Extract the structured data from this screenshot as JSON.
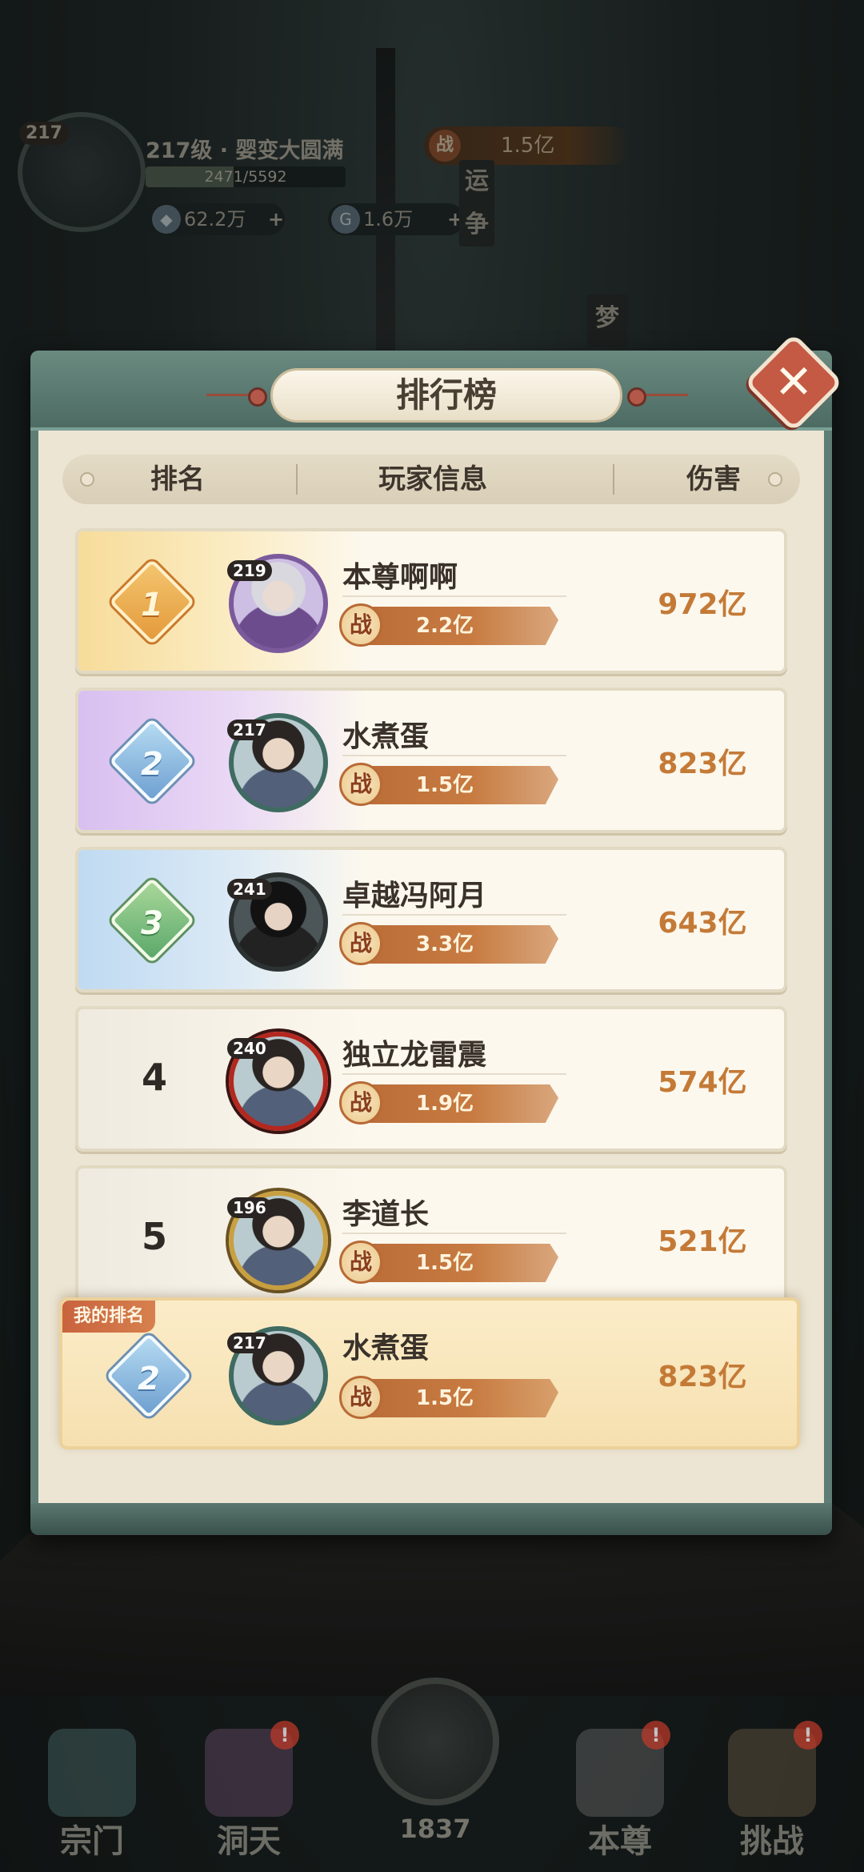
{
  "hud": {
    "player_level": "217",
    "rank_text": "217级 · 婴变大圆满",
    "exp_text": "2471/5592",
    "exp_fraction": 0.4419,
    "res1_value": "62.2万",
    "res2_value": "1.6万",
    "plus": "+",
    "power_label": "战",
    "power_value": "1.5亿",
    "side_text": "运争",
    "meng": "梦"
  },
  "dialog": {
    "title": "排行榜",
    "close_icon": "close-icon",
    "columns": [
      "排名",
      "玩家信息",
      "伤害"
    ],
    "power_label": "战",
    "rows": [
      {
        "rank": "1",
        "level": "219",
        "name": "本尊啊啊",
        "power": "2.2亿",
        "damage": "972亿"
      },
      {
        "rank": "2",
        "level": "217",
        "name": "水煮蛋",
        "power": "1.5亿",
        "damage": "823亿"
      },
      {
        "rank": "3",
        "level": "241",
        "name": "卓越冯阿月",
        "power": "3.3亿",
        "damage": "643亿"
      },
      {
        "rank": "4",
        "level": "240",
        "name": "独立龙雷震",
        "power": "1.9亿",
        "damage": "574亿"
      },
      {
        "rank": "5",
        "level": "196",
        "name": "李道长",
        "power": "1.5亿",
        "damage": "521亿"
      }
    ],
    "mine": {
      "tag": "我的排名",
      "rank": "2",
      "level": "217",
      "name": "水煮蛋",
      "power": "1.5亿",
      "damage": "823亿"
    }
  },
  "nav": {
    "items": [
      "宗门",
      "洞天",
      "本尊",
      "挑战"
    ],
    "alert": "!",
    "center_count": "1837"
  }
}
